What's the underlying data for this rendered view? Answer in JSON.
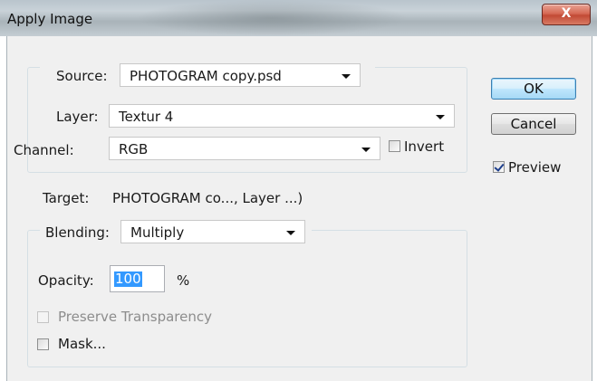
{
  "window": {
    "title": "Apply Image",
    "close_glyph": "X"
  },
  "source": {
    "label": "Source:",
    "file": "PHOTOGRAM copy.psd",
    "layer_label": "Layer:",
    "layer": "Textur 4",
    "channel_label": "Channel:",
    "channel": "RGB",
    "invert_label": "Invert",
    "invert_checked": false
  },
  "target": {
    "label": "Target:",
    "value": "PHOTOGRAM co..., Layer ...)"
  },
  "blending": {
    "label": "Blending:",
    "mode": "Multiply",
    "opacity_label": "Opacity:",
    "opacity": "100",
    "percent": "%",
    "preserve_label": "Preserve Transparency",
    "preserve_checked": false,
    "preserve_enabled": false,
    "mask_label": "Mask...",
    "mask_checked": false
  },
  "buttons": {
    "ok": "OK",
    "cancel": "Cancel"
  },
  "preview": {
    "label": "Preview",
    "checked": true
  },
  "colors": {
    "accent_selection": "#3399ff",
    "close_button": "#c24a35",
    "dialog_bg": "#f0f0f0"
  }
}
